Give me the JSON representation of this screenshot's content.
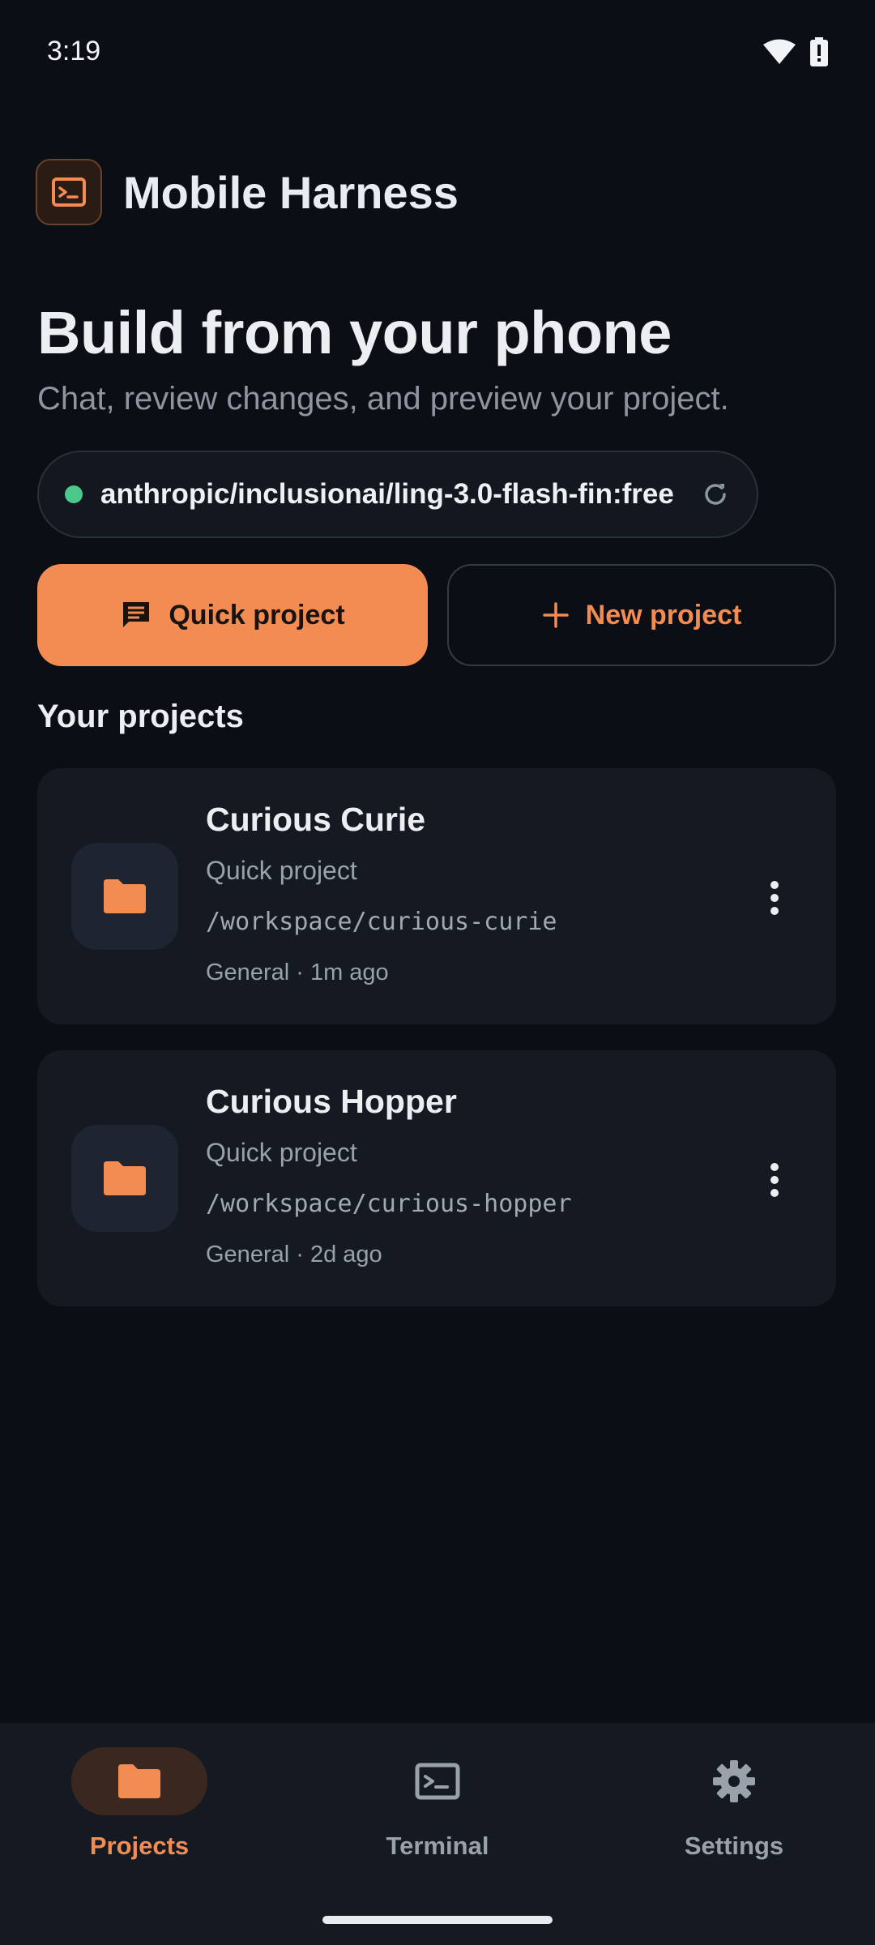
{
  "status_bar": {
    "time": "3:19",
    "icons": [
      "wifi-icon",
      "battery-alert-icon"
    ]
  },
  "app": {
    "title": "Mobile Harness",
    "logo_icon": "terminal-icon"
  },
  "hero": {
    "title": "Build from your phone",
    "subtitle": "Chat, review changes, and preview your project."
  },
  "model_chip": {
    "model": "anthropic/inclusionai/ling-3.0-flash-fin:free",
    "status_color": "#4cc98a",
    "refresh_icon": "refresh-icon"
  },
  "actions": {
    "quick_project": {
      "label": "Quick project",
      "icon": "chat-icon"
    },
    "new_project": {
      "label": "New project",
      "icon": "plus-icon"
    }
  },
  "projects": {
    "section_title": "Your projects",
    "items": [
      {
        "name": "Curious Curie",
        "type": "Quick project",
        "path": "/workspace/curious-curie",
        "meta": "General · 1m ago"
      },
      {
        "name": "Curious Hopper",
        "type": "Quick project",
        "path": "/workspace/curious-hopper",
        "meta": "General · 2d ago"
      }
    ]
  },
  "bottom_nav": {
    "items": [
      {
        "label": "Projects",
        "icon": "folder-icon",
        "active": true
      },
      {
        "label": "Terminal",
        "icon": "terminal-icon",
        "active": false
      },
      {
        "label": "Settings",
        "icon": "gear-icon",
        "active": false
      }
    ]
  },
  "colors": {
    "accent": "#f28c52",
    "background": "#0b0e14",
    "card": "#151a22",
    "success": "#4cc98a"
  }
}
